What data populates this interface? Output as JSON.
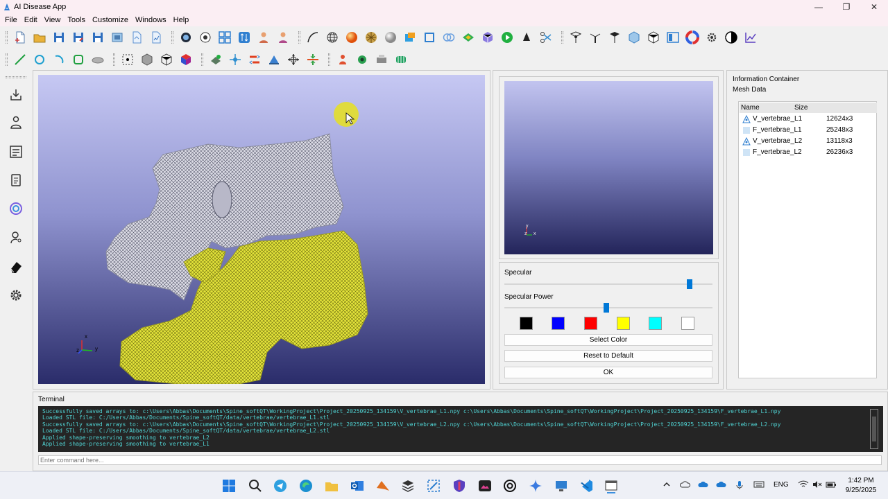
{
  "window": {
    "title": "AI Disease App",
    "controls": [
      "—",
      "❐",
      "✕"
    ]
  },
  "menu": [
    "File",
    "Edit",
    "View",
    "Tools",
    "Customize",
    "Windows",
    "Help"
  ],
  "viewport": {
    "axis_x": "x",
    "axis_y": "y",
    "axis_z": "z",
    "mesh_colors": {
      "vertebra_l1": "#dcdce6",
      "vertebra_l2": "#e0e040"
    }
  },
  "mini_view": {
    "axis_y": "y",
    "axis_z": "z",
    "axis_x": "x"
  },
  "properties": {
    "specular_label": "Specular",
    "specular_value": 0.89,
    "specular_power_label": "Specular Power",
    "specular_power_value": 0.49,
    "swatches": [
      "#000000",
      "#0000ff",
      "#ff0000",
      "#ffff00",
      "#00ffff",
      "#ffffff"
    ],
    "select_color": "Select Color",
    "reset_default": "Reset to Default",
    "ok": "OK"
  },
  "info": {
    "title": "Information Container",
    "mesh_title": "Mesh Data",
    "col_name": "Name",
    "col_size": "Size",
    "rows": [
      {
        "name": "V_vertebrae_L1",
        "size": "12624x3",
        "icon": "vertex-icon"
      },
      {
        "name": "F_vertebrae_L1",
        "size": "25248x3",
        "icon": "face-icon"
      },
      {
        "name": "V_vertebrae_L2",
        "size": "13118x3",
        "icon": "vertex-icon"
      },
      {
        "name": "F_vertebrae_L2",
        "size": "26236x3",
        "icon": "face-icon"
      }
    ]
  },
  "terminal": {
    "label": "Terminal",
    "lines": [
      "Successfully saved arrays to: c:\\Users\\Abbas\\Documents\\Spine_softQT\\WorkingProject\\Project_20250925_134159\\V_vertebrae_L1.npy c:\\Users\\Abbas\\Documents\\Spine_softQT\\WorkingProject\\Project_20250925_134159\\F_vertebrae_L1.npy",
      "Loaded STL file: C:/Users/Abbas/Documents/Spine_softQT/data/vertebrae/vertebrae_L1.stl",
      "Successfully saved arrays to: c:\\Users\\Abbas\\Documents\\Spine_softQT\\WorkingProject\\Project_20250925_134159\\V_vertebrae_L2.npy c:\\Users\\Abbas\\Documents\\Spine_softQT\\WorkingProject\\Project_20250925_134159\\F_vertebrae_L2.npy",
      "Loaded STL file: C:/Users/Abbas/Documents/Spine_softQT/data/vertebrae/vertebrae_L2.stl",
      "Applied shape-preserving smoothing to vertebrae_L2",
      "Applied shape-preserving smoothing to vertebrae_L1"
    ],
    "input_placeholder": "Enter command here..."
  },
  "taskbar": {
    "lang": "ENG",
    "time": "1:42 PM",
    "date": "9/25/2025"
  }
}
